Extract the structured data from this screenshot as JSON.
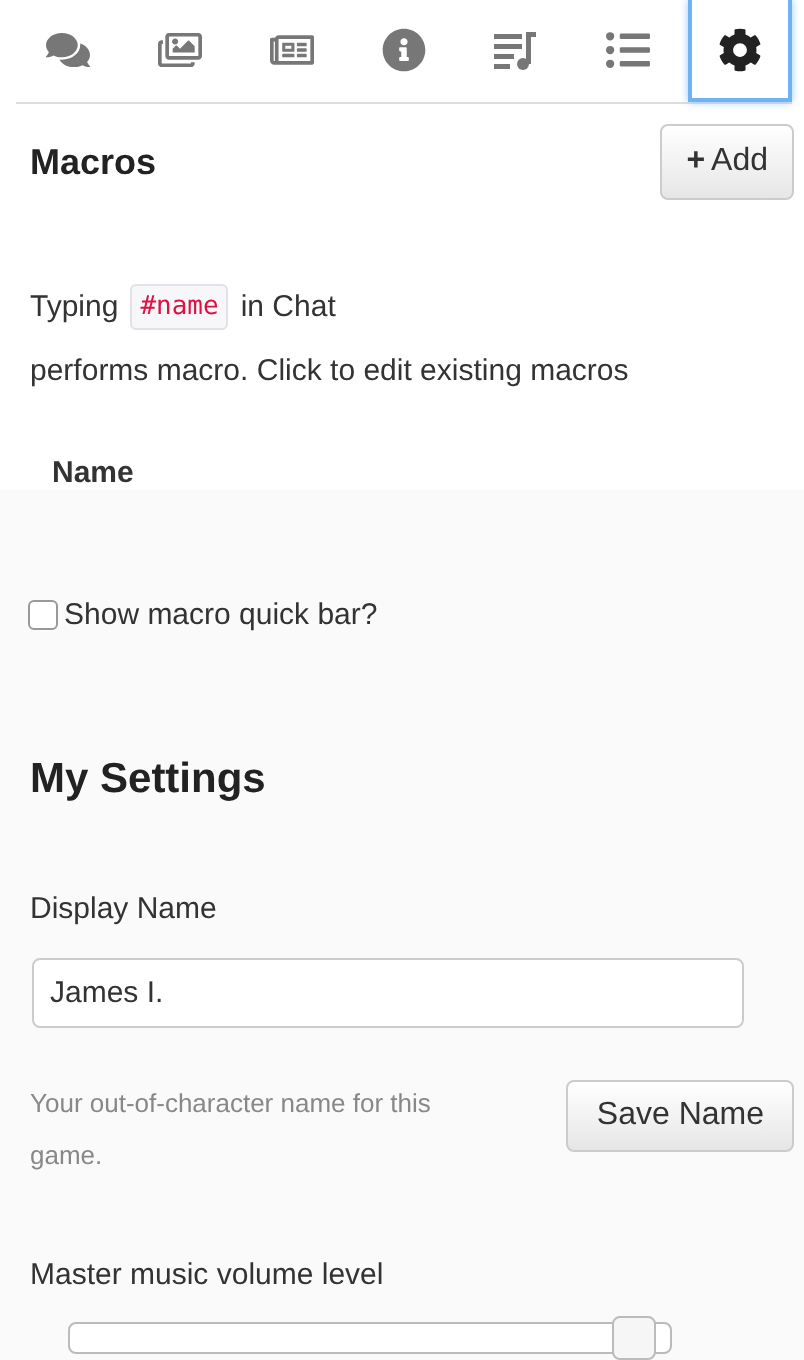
{
  "tabs": [
    {
      "kind": "chat",
      "selected": false
    },
    {
      "kind": "images",
      "selected": false
    },
    {
      "kind": "journal",
      "selected": false
    },
    {
      "kind": "info",
      "selected": false
    },
    {
      "kind": "music",
      "selected": false
    },
    {
      "kind": "list",
      "selected": false
    },
    {
      "kind": "settings",
      "selected": true
    }
  ],
  "macros": {
    "title": "Macros",
    "add_button": "Add",
    "add_icon": "+",
    "intro_before": "Typing",
    "intro_code": "#name",
    "intro_after": "in Chat",
    "intro_line2": "performs macro. Click to edit existing macros",
    "column": "Name",
    "quick_bar": {
      "label": "Show macro quick bar?",
      "checked": false
    }
  },
  "settings": {
    "title": "My Settings",
    "display_name": {
      "label": "Display Name",
      "value": "James I."
    },
    "help": "Your out-of-character name for this game.",
    "save_button": "Save Name",
    "volume": {
      "label": "Master music volume level",
      "level": 0.97
    }
  }
}
